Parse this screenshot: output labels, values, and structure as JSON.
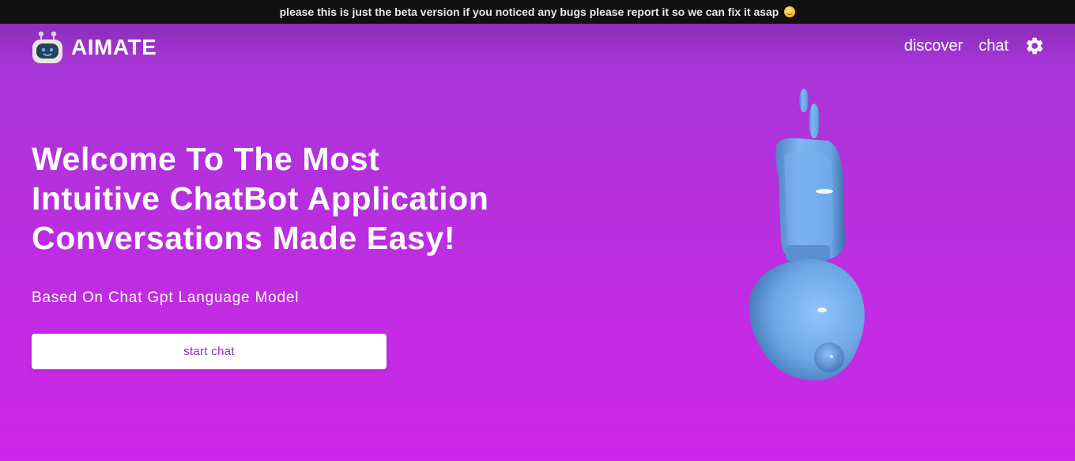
{
  "banner": {
    "text": "please this is just the beta version if you noticed any bugs please report it so we can fix it asap",
    "emoji_icon": "smiling-face-icon"
  },
  "navbar": {
    "brand_name": "AIMATE",
    "logo_icon": "robot-logo-icon",
    "links": [
      {
        "label": "discover"
      },
      {
        "label": "chat"
      }
    ],
    "settings_icon": "gear-icon"
  },
  "hero": {
    "title_lines": [
      "Welcome To The Most",
      "Intuitive ChatBot Application",
      "Conversations Made Easy!"
    ],
    "subtitle": "Based On Chat Gpt Language Model",
    "cta_label": "start chat"
  },
  "colors": {
    "background_top": "#a935d6",
    "background_bottom": "#cf26e9",
    "banner_bg": "#111111",
    "button_text": "#8b2fb0",
    "robot_model": "#7db3f0"
  }
}
